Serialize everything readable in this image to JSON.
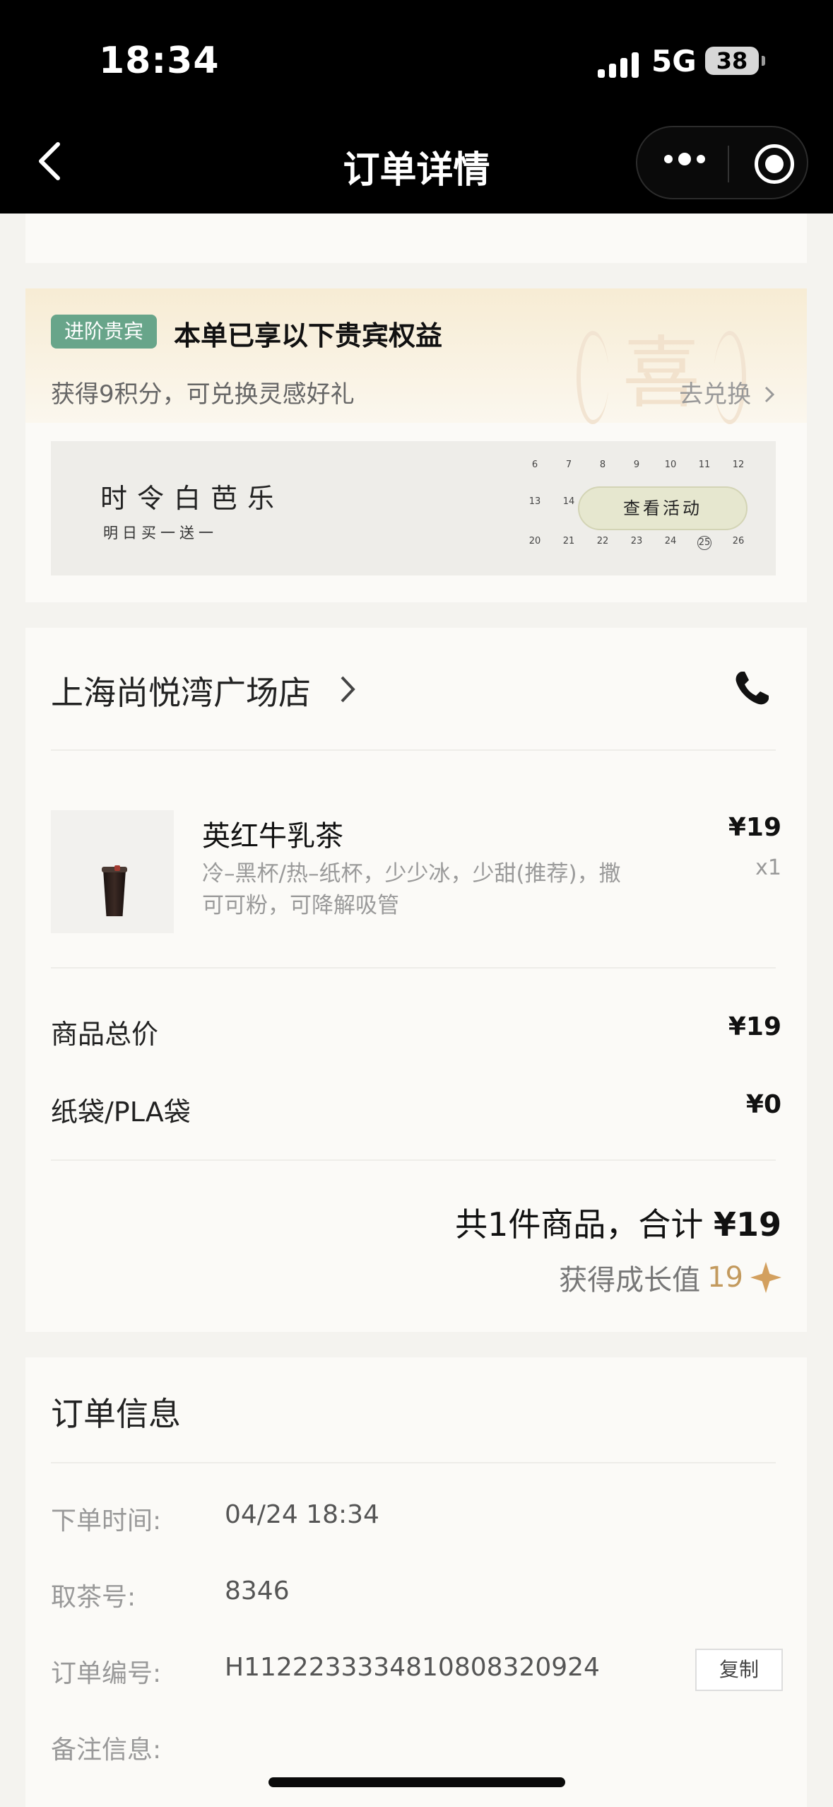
{
  "status_bar": {
    "time": "18:34",
    "network": "5G",
    "battery": "38"
  },
  "nav": {
    "title": "订单详情"
  },
  "benefits": {
    "badge": "进阶贵宾",
    "title": "本单已享以下贵宾权益",
    "points_text": "获得9积分，可兑换灵感好礼",
    "redeem_link": "去兑换",
    "seal_char": "喜",
    "banner": {
      "title": "时令白芭乐",
      "subtitle": "明日买一送一",
      "button": "查看活动",
      "calendar_days": [
        "6",
        "7",
        "8",
        "9",
        "10",
        "11",
        "12",
        "13",
        "14",
        "20",
        "21",
        "22",
        "23",
        "24",
        "25",
        "26"
      ]
    }
  },
  "store": {
    "name": "上海尚悦湾广场店"
  },
  "product": {
    "name": "英红牛乳茶",
    "spec": "冷–黑杯/热–纸杯，少少冰，少甜(推荐)，撒可可粉，可降解吸管",
    "price": "¥19",
    "qty": "x1"
  },
  "costs": [
    {
      "label": "商品总价",
      "value": "¥19"
    },
    {
      "label": "纸袋/PLA袋",
      "value": "¥0"
    }
  ],
  "summary": {
    "prefix": "共1件商品，合计 ",
    "amount": "¥19",
    "growth_label": "获得成长值",
    "growth_value": "19"
  },
  "order_info": {
    "title": "订单信息",
    "rows": [
      {
        "label": "下单时间:",
        "value": "04/24 18:34"
      },
      {
        "label": "取茶号:",
        "value": "8346"
      },
      {
        "label": "订单编号:",
        "value": "H1122233334810808320924"
      },
      {
        "label": "备注信息:",
        "value": ""
      }
    ],
    "copy_button": "复制"
  },
  "colors": {
    "vip_green": "#68a58a",
    "gold": "#c39a5e",
    "background": "#f4f3ef"
  }
}
